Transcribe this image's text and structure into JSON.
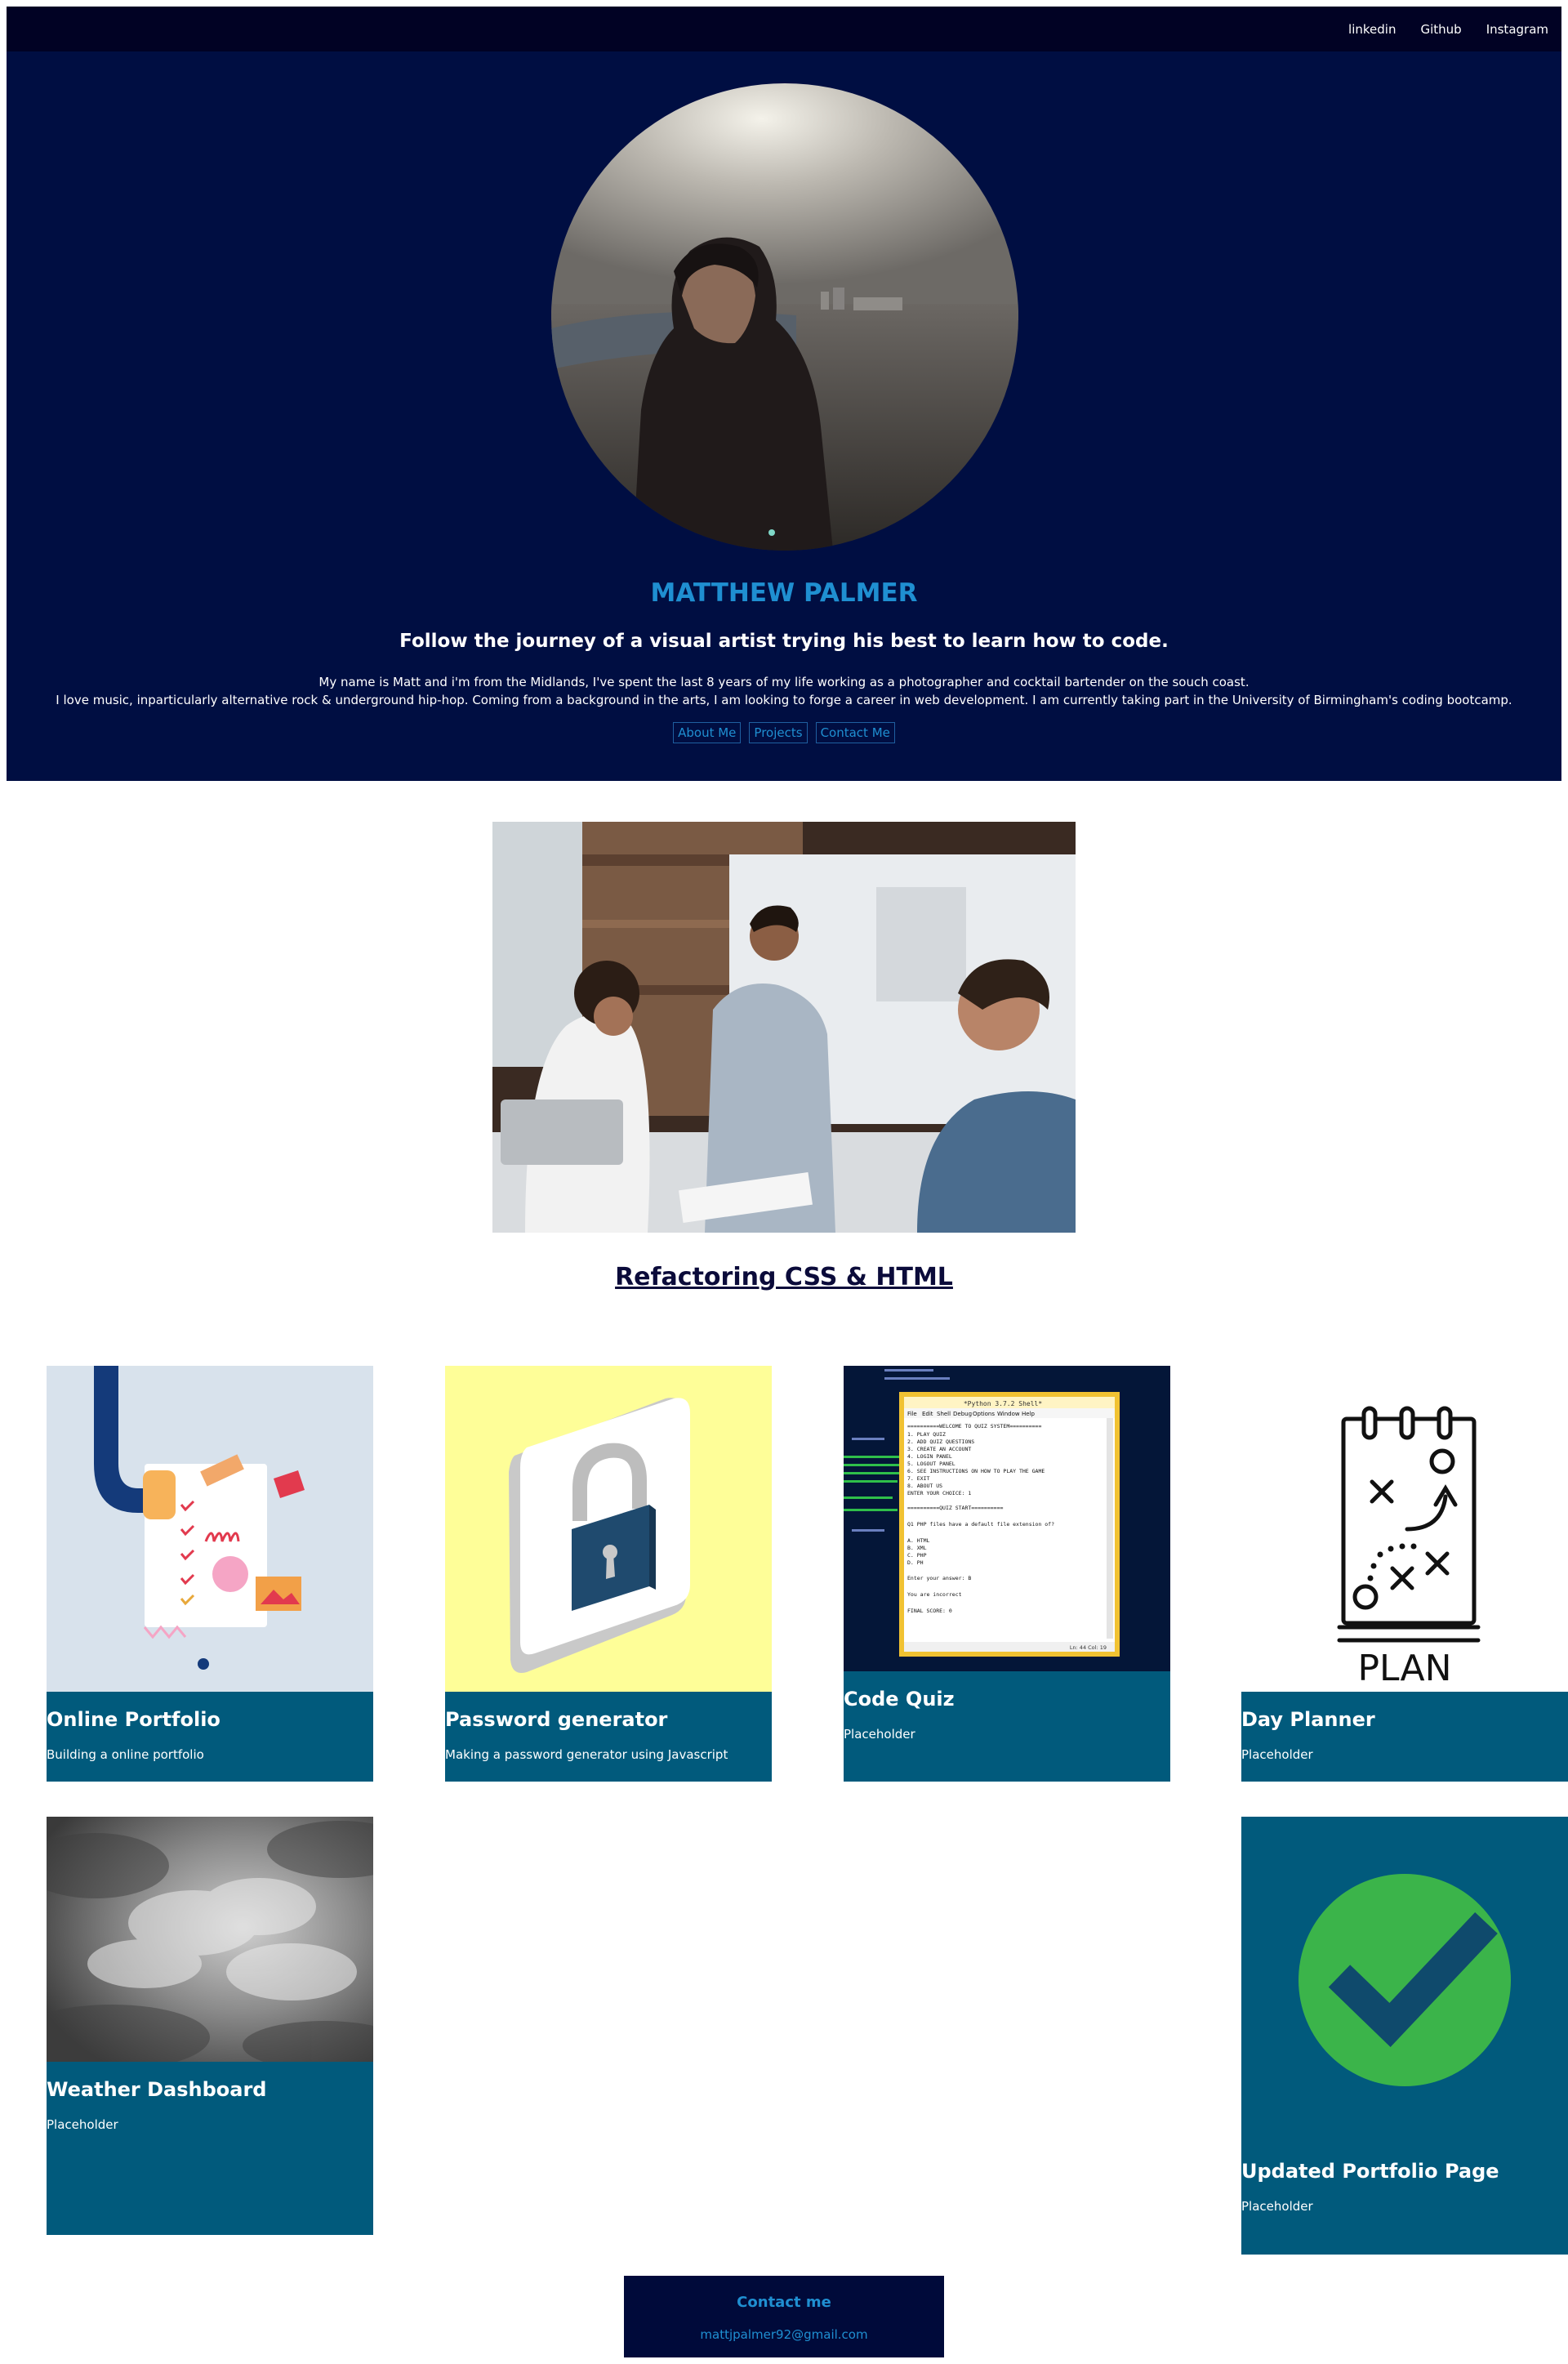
{
  "nav": {
    "links": [
      "linkedin",
      "Github",
      "Instagram"
    ]
  },
  "hero": {
    "name": "MATTHEW PALMER",
    "tagline": "Follow the journey of a visual artist trying his best to learn how to code.",
    "bio_line1": "My name is Matt and i'm from the Midlands, I've spent the last 8 years of my life working as a photographer and cocktail bartender on the souch coast.",
    "bio_line2": "I love music, inparticularly alternative rock & underground hip-hop. Coming from a background in the arts, I am looking to forge a career in web development. I am currently taking part in the University of Birmingham's coding bootcamp.",
    "buttons": [
      "About Me",
      "Projects",
      "Contact Me"
    ],
    "avatar_icon": "profile-photo"
  },
  "feature": {
    "title": "Refactoring CSS & HTML",
    "image_icon": "team-meeting-photo"
  },
  "projects": [
    {
      "title": "Online Portfolio",
      "desc": "Building a online portfolio",
      "icon": "checklist-illustration"
    },
    {
      "title": "Password generator",
      "desc": "Making a password generator using Javascript",
      "icon": "padlock-illustration"
    },
    {
      "title": "Code Quiz",
      "desc": "Placeholder",
      "icon": "python-shell-screenshot"
    },
    {
      "title": "Day Planner",
      "desc": "Placeholder",
      "icon": "plan-calendar-icon"
    },
    {
      "title": "Weather Dashboard",
      "desc": "Placeholder",
      "icon": "storm-clouds-photo"
    },
    {
      "title": "Updated Portfolio Page",
      "desc": "Placeholder",
      "icon": "checkmark-icon"
    }
  ],
  "screenshot_text": {
    "window_title": "*Python 3.7.2 Shell*",
    "menu": [
      "File",
      "Edit",
      "Shell",
      "Debug",
      "Options",
      "Window",
      "Help"
    ],
    "lines": [
      "==========WELCOME TO QUIZ SYSTEM==========",
      "1. PLAY QUIZ",
      "2. ADD QUIZ QUESTIONS",
      "3. CREATE AN ACCOUNT",
      "4. LOGIN PANEL",
      "5. LOGOUT PANEL",
      "6. SEE INSTRUCTIONS ON HOW TO PLAY THE GAME",
      "7. EXIT",
      "8. ABOUT US",
      "ENTER YOUR CHOICE: 1",
      "==========QUIZ START==========",
      "Q1 PHP files have a default file extension of?",
      "A. HTML",
      "B. XML",
      "C. PHP",
      "D. PH",
      "Enter your answer: B",
      "You are incorrect",
      "FINAL SCORE: 0"
    ],
    "status": "Ln: 44   Col: 19",
    "plan_label": "PLAN"
  },
  "contact": {
    "title": "Contact me",
    "email": "mattjpalmer92@gmail.com"
  },
  "colors": {
    "header_bg": "#000e42",
    "nav_bg": "#010224",
    "accent": "#1f8fd1",
    "card_caption_bg": "#015a7c"
  }
}
